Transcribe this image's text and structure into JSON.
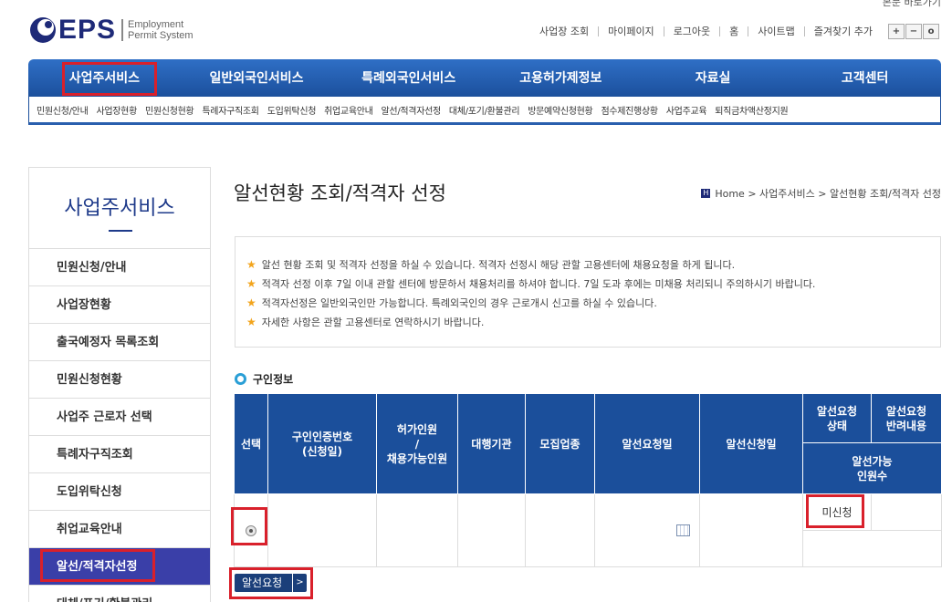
{
  "header": {
    "top_cut_text": "본문 바로가기",
    "logo": {
      "brand": "EPS",
      "sub_line1": "Employment",
      "sub_line2": "Permit System"
    },
    "util_links": [
      "사업장 조회",
      "마이페이지",
      "로그아웃",
      "홈",
      "사이트맵",
      "즐겨찾기 추가"
    ],
    "zoom": {
      "plus": "+",
      "minus": "−",
      "reset": "o"
    }
  },
  "gnb": [
    "사업주서비스",
    "일반외국인서비스",
    "특례외국인서비스",
    "고용허가제정보",
    "자료실",
    "고객센터"
  ],
  "sub_nav": [
    "민원신청/안내",
    "사업장현황",
    "민원신청현황",
    "특례자구직조회",
    "도입위탁신청",
    "취업교육안내",
    "알선/적격자선정",
    "대체/포기/환불관리",
    "방문예약신청현황",
    "점수제진행상황",
    "사업주교육",
    "퇴직금차액산정지원"
  ],
  "lnb": {
    "title": "사업주서비스",
    "items": [
      "민원신청/안내",
      "사업장현황",
      "출국예정자 목록조회",
      "민원신청현황",
      "사업주 근로자 선택",
      "특례자구직조회",
      "도입위탁신청",
      "취업교육안내",
      "알선/적격자선정",
      "대체/포기/환불관리"
    ]
  },
  "content": {
    "title": "알선현황 조회/적격자 선정",
    "breadcrumb": "Home > 사업주서비스 > 알선현황 조회/적격자 선정",
    "notices": [
      "알선 현황 조회 및 적격자 선정을 하실 수 있습니다. 적격자 선정시 해당 관할 고용센터에 채용요청을 하게 됩니다.",
      "적격자 선정 이후 7일 이내 관할 센터에 방문하서 채용처리를 하셔야 합니다. 7일 도과 후에는 미채용 처리되니 주의하시기 바랍니다.",
      "적격자선정은 일반외국인만 가능합니다. 특례외국인의 경우 근로개시 신고를 하실 수 있습니다.",
      "자세한 사항은 관할 고용센터로 연락하시기 바랍니다."
    ],
    "section_title": "구인정보",
    "table": {
      "h_select": "선택",
      "h_cert_1": "구인인증번호",
      "h_cert_2": "(신청일)",
      "h_permit_1": "허가인원",
      "h_permit_2": "/",
      "h_permit_3": "채용가능인원",
      "h_agency": "대행기관",
      "h_industry": "모집업종",
      "h_req_date": "알선요청일",
      "h_app_date": "알선신청일",
      "h_status_1": "알선요청",
      "h_status_2": "상태",
      "h_reject_1": "알선요청",
      "h_reject_2": "반려내용",
      "h_avail_1": "알선가능",
      "h_avail_2": "인원수",
      "row_status": "미신청"
    },
    "button": "알선요청"
  }
}
